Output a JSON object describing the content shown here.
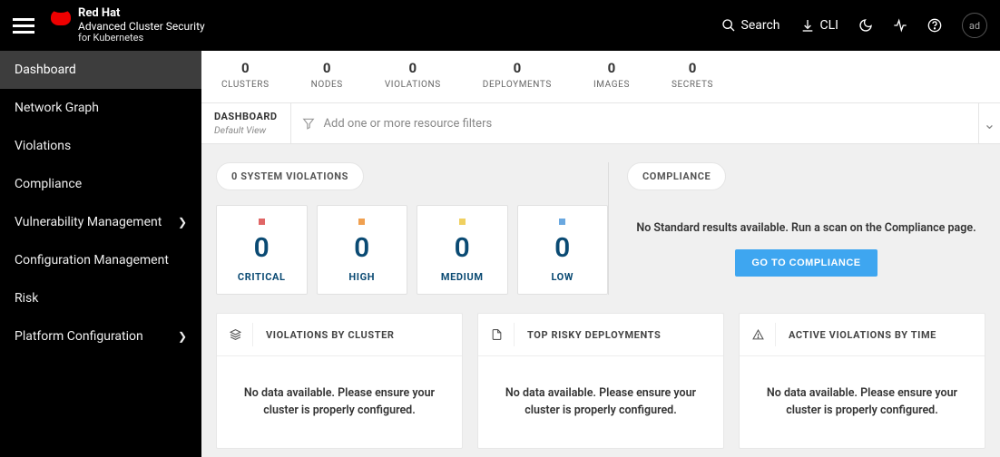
{
  "brand": {
    "l1": "Red Hat",
    "l2": "Advanced Cluster Security",
    "l3": "for Kubernetes"
  },
  "topbar": {
    "search": "Search",
    "cli": "CLI",
    "avatar": "ad"
  },
  "sidebar": {
    "items": [
      {
        "label": "Dashboard",
        "has_sub": false,
        "active": true
      },
      {
        "label": "Network Graph",
        "has_sub": false,
        "active": false
      },
      {
        "label": "Violations",
        "has_sub": false,
        "active": false
      },
      {
        "label": "Compliance",
        "has_sub": false,
        "active": false
      },
      {
        "label": "Vulnerability Management",
        "has_sub": true,
        "active": false
      },
      {
        "label": "Configuration Management",
        "has_sub": false,
        "active": false
      },
      {
        "label": "Risk",
        "has_sub": false,
        "active": false
      },
      {
        "label": "Platform Configuration",
        "has_sub": true,
        "active": false
      }
    ]
  },
  "counts": [
    {
      "value": "0",
      "label": "CLUSTERS"
    },
    {
      "value": "0",
      "label": "NODES"
    },
    {
      "value": "0",
      "label": "VIOLATIONS"
    },
    {
      "value": "0",
      "label": "DEPLOYMENTS"
    },
    {
      "value": "0",
      "label": "IMAGES"
    },
    {
      "value": "0",
      "label": "SECRETS"
    }
  ],
  "dashboard": {
    "title": "DASHBOARD",
    "subtitle": "Default View",
    "filter_placeholder": "Add one or more resource filters"
  },
  "violations_panel": {
    "title": "0 SYSTEM VIOLATIONS",
    "severities": [
      {
        "name": "CRITICAL",
        "value": "0",
        "color": "#e06666"
      },
      {
        "name": "HIGH",
        "value": "0",
        "color": "#f0a050"
      },
      {
        "name": "MEDIUM",
        "value": "0",
        "color": "#f0d060"
      },
      {
        "name": "LOW",
        "value": "0",
        "color": "#6aa8e0"
      }
    ]
  },
  "compliance_panel": {
    "title": "COMPLIANCE",
    "message": "No Standard results available. Run a scan on the Compliance page.",
    "button": "GO TO COMPLIANCE"
  },
  "cards": [
    {
      "title": "VIOLATIONS BY CLUSTER",
      "body": "No data available. Please ensure your cluster is properly configured.",
      "icon": "layers"
    },
    {
      "title": "TOP RISKY DEPLOYMENTS",
      "body": "No data available. Please ensure your cluster is properly configured.",
      "icon": "file"
    },
    {
      "title": "ACTIVE VIOLATIONS BY TIME",
      "body": "No data available. Please ensure your cluster is properly configured.",
      "icon": "alert"
    }
  ]
}
